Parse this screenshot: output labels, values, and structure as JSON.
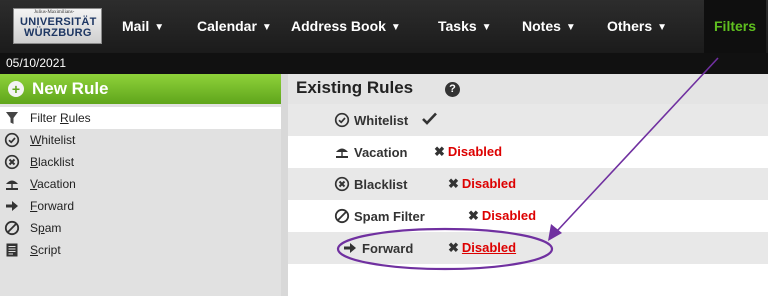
{
  "logo": {
    "line1": "Julius-Maximilians-",
    "line2": "UNIVERSITÄT",
    "line3": "WÜRZBURG"
  },
  "nav": [
    {
      "label": "Mail"
    },
    {
      "label": "Calendar"
    },
    {
      "label": "Address Book"
    },
    {
      "label": "Tasks"
    },
    {
      "label": "Notes"
    },
    {
      "label": "Others"
    },
    {
      "label": "Filters"
    }
  ],
  "date": "05/10/2021",
  "sidebar": {
    "new_rule": "New Rule",
    "items": [
      {
        "label": "Filter Rules",
        "mnemonic": "R",
        "icon": "funnel-icon"
      },
      {
        "label": "Whitelist",
        "mnemonic": "W",
        "icon": "check-circle-icon"
      },
      {
        "label": "Blacklist",
        "mnemonic": "B",
        "icon": "x-circle-icon"
      },
      {
        "label": "Vacation",
        "mnemonic": "V",
        "icon": "beach-umbrella-icon"
      },
      {
        "label": "Forward",
        "mnemonic": "F",
        "icon": "arrow-right-icon"
      },
      {
        "label": "Spam",
        "mnemonic": "p",
        "icon": "no-entry-icon"
      },
      {
        "label": "Script",
        "mnemonic": "S",
        "icon": "script-icon"
      }
    ]
  },
  "main": {
    "heading": "Existing Rules",
    "rules": [
      {
        "name": "Whitelist",
        "icon": "check-circle-icon",
        "status": ""
      },
      {
        "name": "Vacation",
        "icon": "beach-umbrella-icon",
        "status": "Disabled"
      },
      {
        "name": "Blacklist",
        "icon": "x-circle-icon",
        "status": "Disabled"
      },
      {
        "name": "Spam Filter",
        "icon": "no-entry-icon",
        "status": "Disabled"
      },
      {
        "name": "Forward",
        "icon": "arrow-right-icon",
        "status": "Disabled"
      }
    ]
  },
  "colors": {
    "accent": "#5fbf1f",
    "annotation": "#7030a0",
    "disabled": "#dd0000"
  }
}
